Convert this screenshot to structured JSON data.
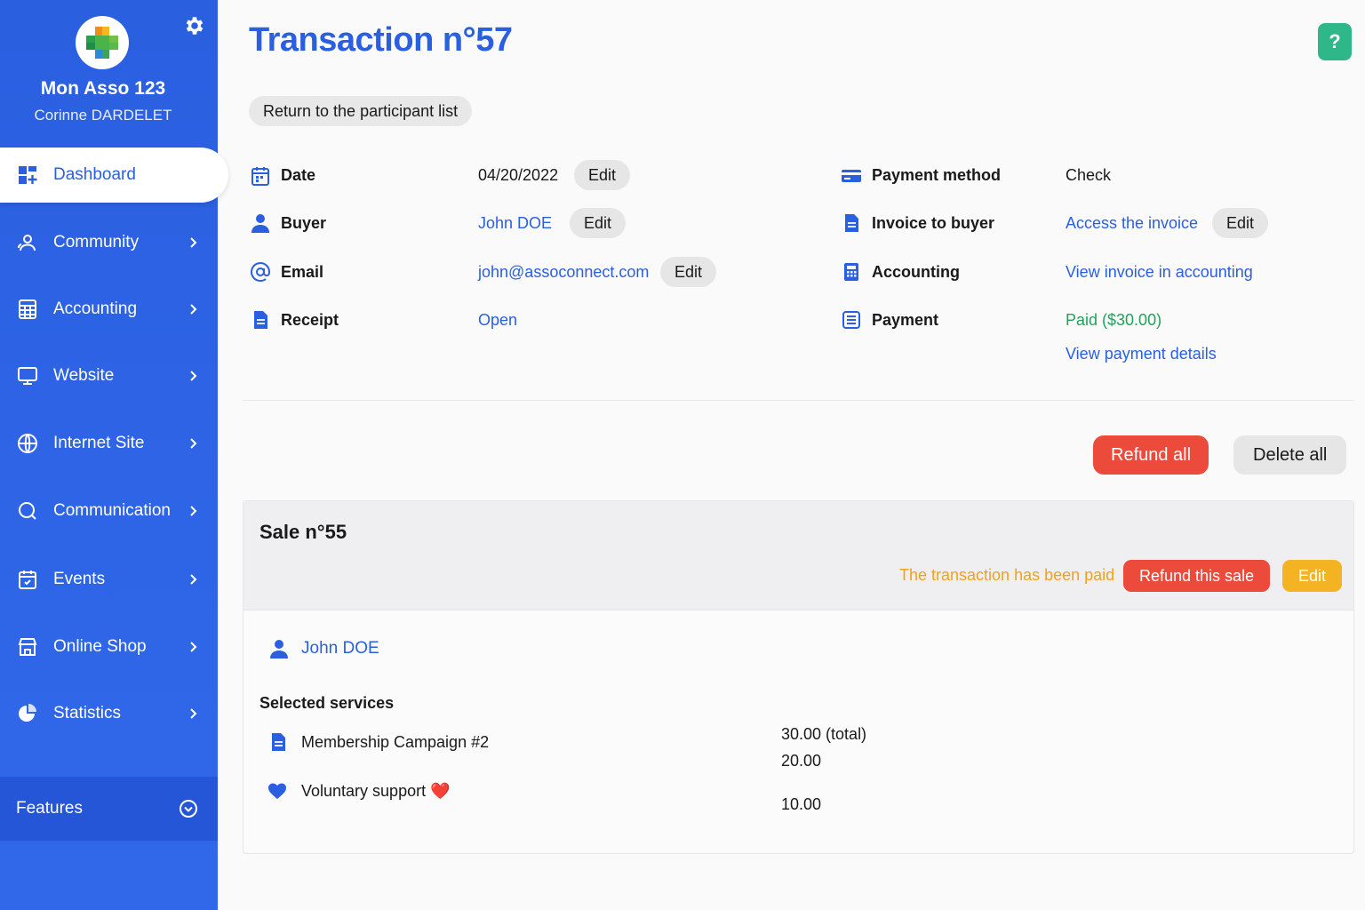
{
  "sidebar": {
    "org_name": "Mon Asso 123",
    "user_name": "Corinne DARDELET",
    "items": [
      {
        "label": "Dashboard",
        "icon": "dashboard-icon"
      },
      {
        "label": "Community",
        "icon": "community-icon"
      },
      {
        "label": "Accounting",
        "icon": "calculator-icon"
      },
      {
        "label": "Website",
        "icon": "monitor-icon"
      },
      {
        "label": "Internet Site",
        "icon": "globe-icon"
      },
      {
        "label": "Communication",
        "icon": "chat-icon"
      },
      {
        "label": "Events",
        "icon": "calendar-icon"
      },
      {
        "label": "Online Shop",
        "icon": "shop-icon"
      },
      {
        "label": "Statistics",
        "icon": "pie-chart-icon"
      }
    ],
    "features_label": "Features"
  },
  "header": {
    "title": "Transaction n°57",
    "back_label": "Return to the participant list",
    "help_label": "?"
  },
  "details": {
    "date_label": "Date",
    "date_value": "04/20/2022",
    "buyer_label": "Buyer",
    "buyer_value": "John DOE",
    "email_label": "Email",
    "email_value": "john@assoconnect.com",
    "receipt_label": "Receipt",
    "receipt_value": "Open",
    "payment_method_label": "Payment method",
    "payment_method_value": "Check",
    "invoice_label": "Invoice to buyer",
    "invoice_value": "Access the invoice",
    "accounting_label": "Accounting",
    "accounting_value": "View invoice in accounting",
    "payment_label": "Payment",
    "payment_value": "Paid ($30.00)",
    "payment_details": "View payment details",
    "edit_label": "Edit"
  },
  "actions": {
    "refund_all": "Refund all",
    "delete_all": "Delete all"
  },
  "sale": {
    "title": "Sale n°55",
    "paid_note": "The transaction has been paid",
    "refund_label": "Refund this sale",
    "edit_label": "Edit",
    "buyer": "John DOE",
    "services_title": "Selected services",
    "services": [
      {
        "name": "Membership Campaign #2",
        "total": "30.00 (total)",
        "amount": "20.00",
        "icon": "document-icon"
      },
      {
        "name": "Voluntary support ❤️",
        "amount": "10.00",
        "icon": "heart-icon"
      }
    ]
  },
  "colors": {
    "primary": "#2a5fe0",
    "danger": "#ec4a3a",
    "warning": "#f3b323",
    "success": "#1fa35a",
    "help": "#2eb88a"
  }
}
